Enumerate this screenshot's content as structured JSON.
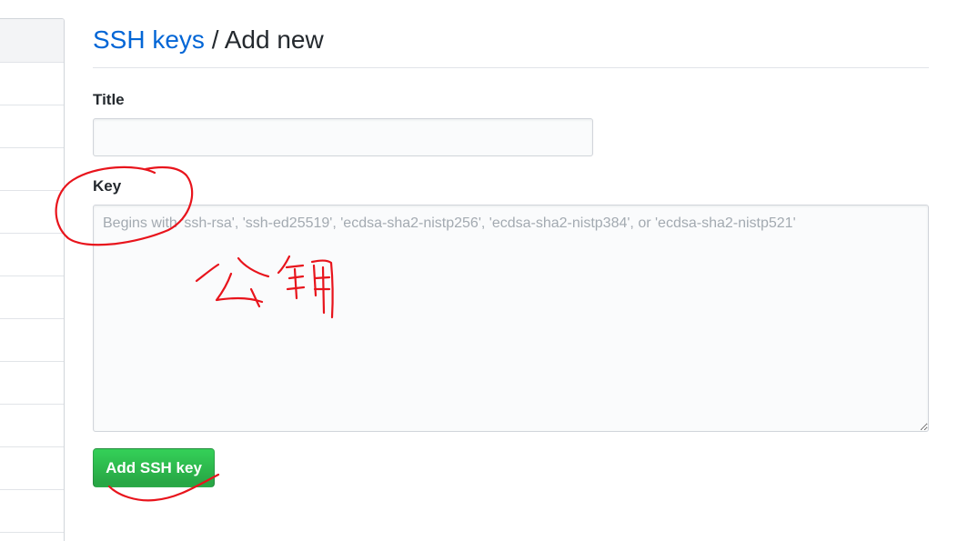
{
  "breadcrumb": {
    "parent": "SSH keys",
    "separator": "/",
    "current": "Add new"
  },
  "form": {
    "title_label": "Title",
    "title_value": "",
    "key_label": "Key",
    "key_value": "",
    "key_placeholder": "Begins with 'ssh-rsa', 'ssh-ed25519', 'ecdsa-sha2-nistp256', 'ecdsa-sha2-nistp384', or 'ecdsa-sha2-nistp521'",
    "submit_label": "Add SSH key"
  },
  "sidebar": {
    "item_count": 11
  },
  "colors": {
    "link": "#0366d6",
    "primary_button": "#28a745",
    "annotation": "#e8141c"
  }
}
